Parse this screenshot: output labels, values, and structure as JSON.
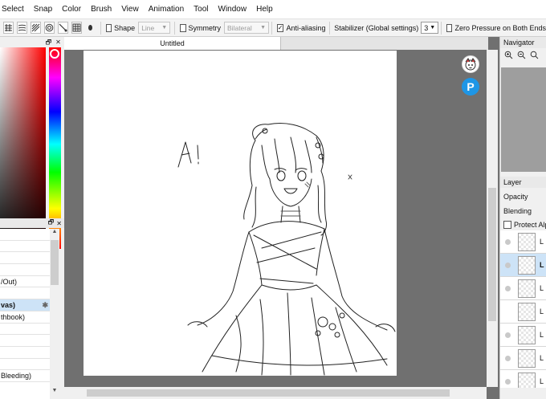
{
  "menu": [
    "Select",
    "Snap",
    "Color",
    "Brush",
    "View",
    "Animation",
    "Tool",
    "Window",
    "Help"
  ],
  "toolbar": {
    "icons": [
      "lines-icon",
      "parallel-lines-icon",
      "perspective-icon",
      "concentric-icon",
      "curve-icon",
      "grid-icon",
      "dot-icon"
    ],
    "shape_label": "Shape",
    "shape_value": "Line",
    "symmetry_label": "Symmetry",
    "symmetry_value": "Bilateral",
    "antialias_label": "Anti-aliasing",
    "antialias_checked": true,
    "stabilizer_label": "Stabilizer (Global settings)",
    "stabilizer_value": "3",
    "zero_pressure_label": "Zero Pressure on Both Ends"
  },
  "document": {
    "tab_title": "Untitled"
  },
  "left_list": {
    "rows": [
      "",
      "",
      "",
      "",
      "/Out)",
      "",
      "vas)",
      "thbook)",
      "",
      "",
      "",
      "",
      "Bleeding)"
    ],
    "selected_index": 6
  },
  "navigator": {
    "title": "Navigator",
    "tools": [
      "zoom-in-icon",
      "zoom-out-icon",
      "zoom-fit-icon"
    ]
  },
  "layer_panel": {
    "title": "Layer",
    "opacity_label": "Opacity",
    "blending_label": "Blending",
    "protect_label": "Protect Alpha",
    "layers": [
      {
        "name": "L",
        "selected": false
      },
      {
        "name": "L",
        "selected": true
      },
      {
        "name": "L",
        "selected": false
      },
      {
        "name": "L",
        "selected": false
      },
      {
        "name": "L",
        "selected": false
      },
      {
        "name": "L",
        "selected": false
      },
      {
        "name": "L",
        "selected": false
      }
    ]
  },
  "sketch": {
    "text": "A!"
  }
}
